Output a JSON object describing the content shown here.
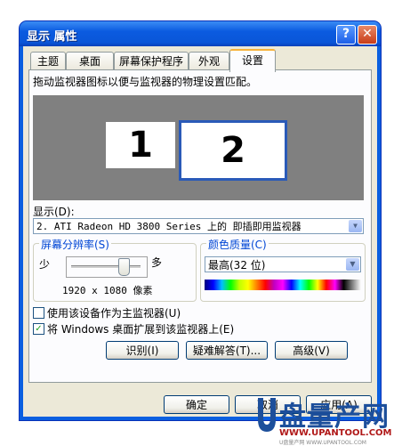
{
  "window": {
    "title": "显示 属性"
  },
  "titlebar": {
    "help_label": "?",
    "close_label": "✕"
  },
  "tabs": [
    {
      "label": "主题"
    },
    {
      "label": "桌面"
    },
    {
      "label": "屏幕保护程序"
    },
    {
      "label": "外观"
    },
    {
      "label": "设置",
      "active": true
    }
  ],
  "settings": {
    "instruction": "拖动监视器图标以便与监视器的物理设置匹配。",
    "monitors": [
      {
        "label": "1"
      },
      {
        "label": "2",
        "selected": true
      }
    ],
    "display_label": "显示(D):",
    "display_value": "2. ATI Radeon HD 3800 Series  上的 即插即用监视器",
    "resolution": {
      "group_label": "屏幕分辨率(S)",
      "less_label": "少",
      "more_label": "多",
      "value": "1920 x 1080 像素",
      "slider_fraction": 0.75
    },
    "color": {
      "group_label": "颜色质量(C)",
      "value": "最高(32 位)"
    },
    "checkboxes": [
      {
        "label": "使用该设备作为主监视器(U)",
        "checked": false
      },
      {
        "label": "将 Windows 桌面扩展到该监视器上(E)",
        "checked": true
      }
    ],
    "buttons": {
      "identify": "识别(I)",
      "troubleshoot": "疑难解答(T)...",
      "advanced": "高级(V)"
    }
  },
  "footer": {
    "ok": "确定",
    "cancel": "取消",
    "apply": "应用(A)"
  },
  "watermark": {
    "text": "盘量产网",
    "url": "WWW.UPANTOOL.COM",
    "sub": "U盘量产网 WWW.UPANTOOL.COM"
  },
  "colors": {
    "title_bar": "#0a5fe0",
    "dialog_bg": "#ece9d8",
    "tab_highlight": "#f8b33a"
  }
}
